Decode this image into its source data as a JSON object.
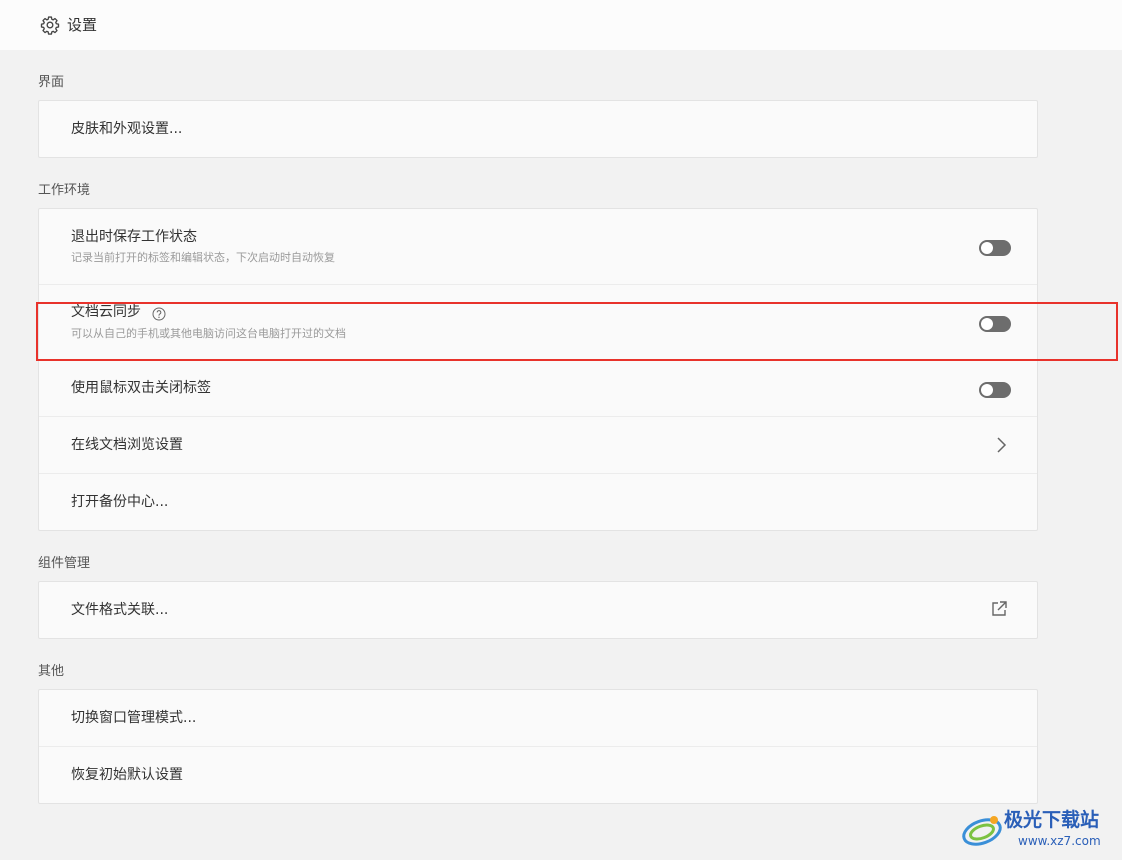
{
  "header": {
    "title": "设置",
    "icon": "gear-icon"
  },
  "sections": {
    "interface": {
      "label": "界面",
      "items": {
        "skin": {
          "label": "皮肤和外观设置..."
        }
      }
    },
    "workspace": {
      "label": "工作环境",
      "items": {
        "save_state": {
          "label": "退出时保存工作状态",
          "desc": "记录当前打开的标签和编辑状态，下次启动时自动恢复",
          "toggle_on": false
        },
        "cloud_sync": {
          "label": "文档云同步",
          "desc": "可以从自己的手机或其他电脑访问这台电脑打开过的文档",
          "toggle_on": false,
          "help_icon": "question-circle-icon"
        },
        "dblclick_close": {
          "label": "使用鼠标双击关闭标签",
          "toggle_on": false
        },
        "online_browse": {
          "label": "在线文档浏览设置",
          "icon": "chevron-right-icon"
        },
        "backup": {
          "label": "打开备份中心..."
        }
      }
    },
    "components": {
      "label": "组件管理",
      "items": {
        "file_assoc": {
          "label": "文件格式关联...",
          "icon": "external-link-icon"
        }
      }
    },
    "other": {
      "label": "其他",
      "items": {
        "window_mode": {
          "label": "切换窗口管理模式..."
        },
        "reset": {
          "label": "恢复初始默认设置"
        }
      }
    }
  },
  "highlight_color": "#e8322b",
  "watermark": {
    "text": "极光下载站",
    "url": "www.xz7.com"
  }
}
